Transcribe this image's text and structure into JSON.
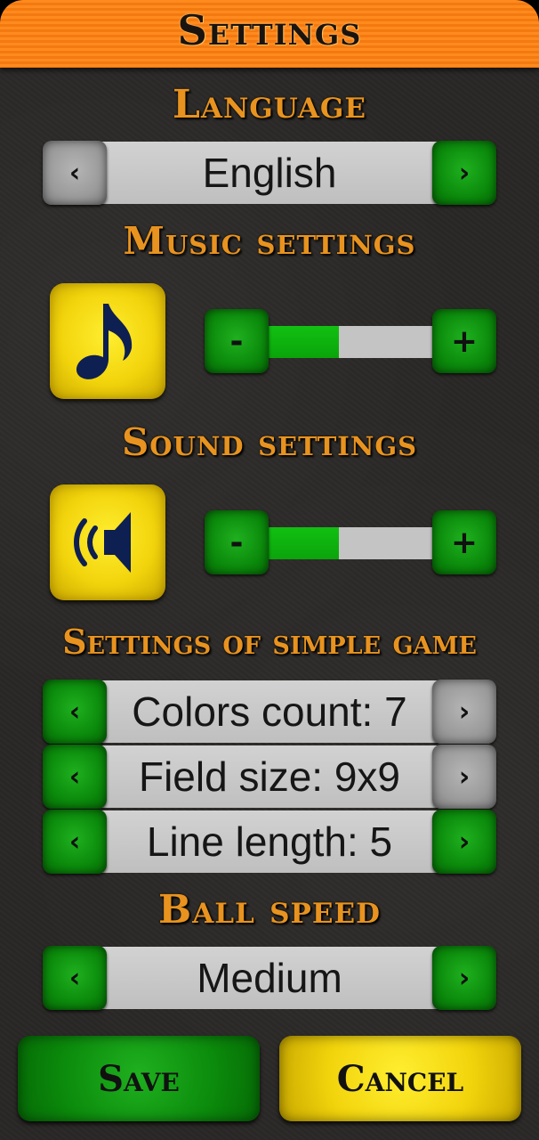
{
  "title": "Settings",
  "language": {
    "heading": "Language",
    "value": "English",
    "prev_icon": "chevron-left-icon",
    "next_icon": "chevron-right-icon"
  },
  "music": {
    "heading": "Music settings",
    "icon": "music-note-icon",
    "minus_label": "-",
    "plus_label": "+",
    "level": 0.45
  },
  "sound": {
    "heading": "Sound settings",
    "icon": "speaker-icon",
    "minus_label": "-",
    "plus_label": "+",
    "level": 0.45
  },
  "simple_game": {
    "heading": "Settings of simple game",
    "options": [
      {
        "label": "Colors count: 7"
      },
      {
        "label": "Field size: 9x9"
      },
      {
        "label": "Line length: 5"
      }
    ]
  },
  "ball_speed": {
    "heading": "Ball speed",
    "value": "Medium"
  },
  "buttons": {
    "save": "Save",
    "cancel": "Cancel"
  },
  "colors": {
    "accent_orange": "#e8931f",
    "green": "#0b8a0b",
    "yellow": "#f2d40c",
    "disabled_gray": "#9a9a9a"
  }
}
